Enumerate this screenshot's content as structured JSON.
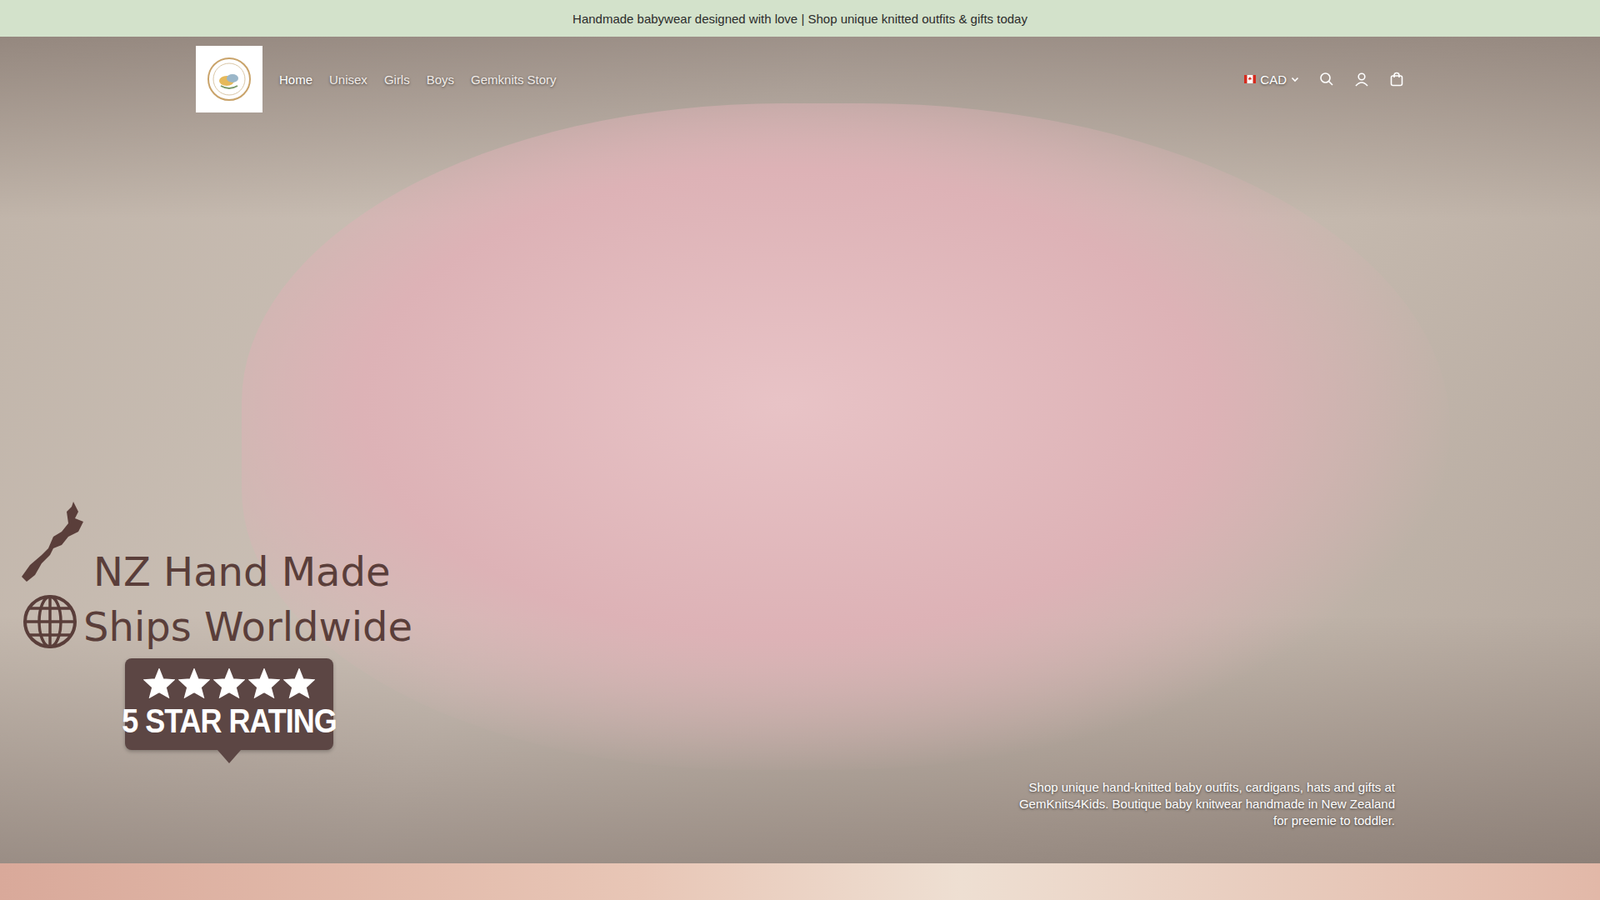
{
  "announcement": "Handmade babywear designed with love | Shop unique knitted outfits & gifts today",
  "nav": [
    {
      "label": "Home",
      "selected": true
    },
    {
      "label": "Unisex",
      "selected": false
    },
    {
      "label": "Girls",
      "selected": false
    },
    {
      "label": "Boys",
      "selected": false
    },
    {
      "label": "Gemknits Story",
      "selected": false
    }
  ],
  "currency": {
    "code": "CAD"
  },
  "hero": {
    "badges": [
      {
        "label": "NZ Hand Made",
        "kind": "map"
      },
      {
        "label": "Ships Worldwide",
        "kind": "globe"
      }
    ],
    "rating": {
      "stars": 5,
      "label": "5 STAR RATING"
    },
    "caption": "Shop unique hand-knitted baby outfits, cardigans, hats and gifts at GemKnits4Kids. Boutique baby knitwear handmade in New Zealand for preemie to toddler."
  }
}
